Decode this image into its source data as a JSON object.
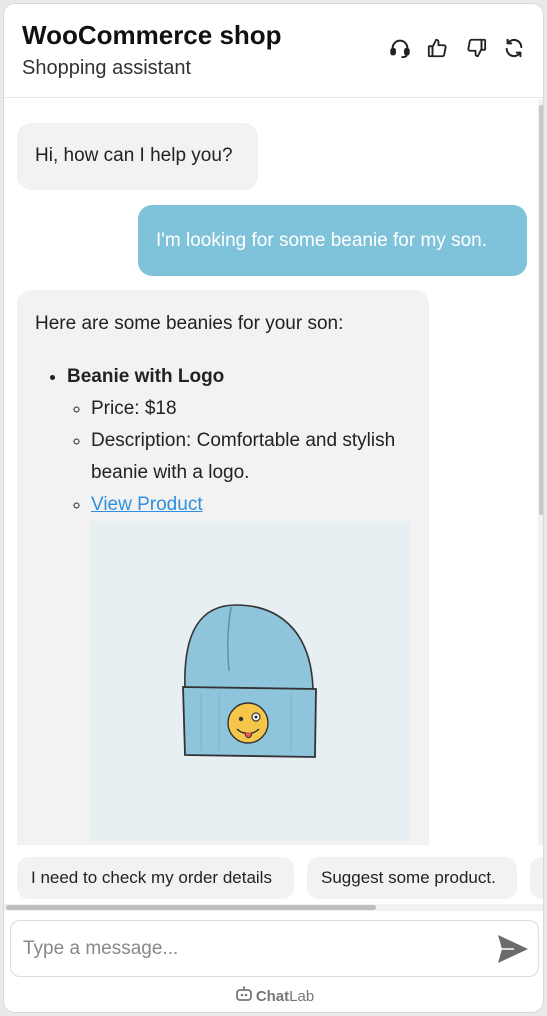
{
  "header": {
    "title": "WooCommerce shop",
    "subtitle": "Shopping assistant",
    "icons": [
      "headset-icon",
      "thumbs-up-icon",
      "thumbs-down-icon",
      "refresh-icon"
    ]
  },
  "messages": [
    {
      "role": "bot",
      "text": "Hi, how can I help you?"
    },
    {
      "role": "user",
      "text": "I'm looking for some beanie for my son."
    },
    {
      "role": "bot",
      "intro": "Here are some beanies for your son:",
      "product": {
        "name": "Beanie with Logo",
        "price": "Price: $18",
        "description": "Description: Comfortable and stylish beanie with a logo.",
        "link": "View Product"
      }
    }
  ],
  "suggestions": [
    "I need to check my order details",
    "Suggest some product.",
    ""
  ],
  "composer": {
    "placeholder": "Type a message..."
  },
  "footer": {
    "brand_bold": "Chat",
    "brand_light": "Lab"
  },
  "colors": {
    "user_bubble": "#7fc3db",
    "bot_bubble": "#f2f2f2",
    "link": "#2f8fe0",
    "beanie": "#8ec5dc",
    "image_bg": "#e8eff2"
  }
}
